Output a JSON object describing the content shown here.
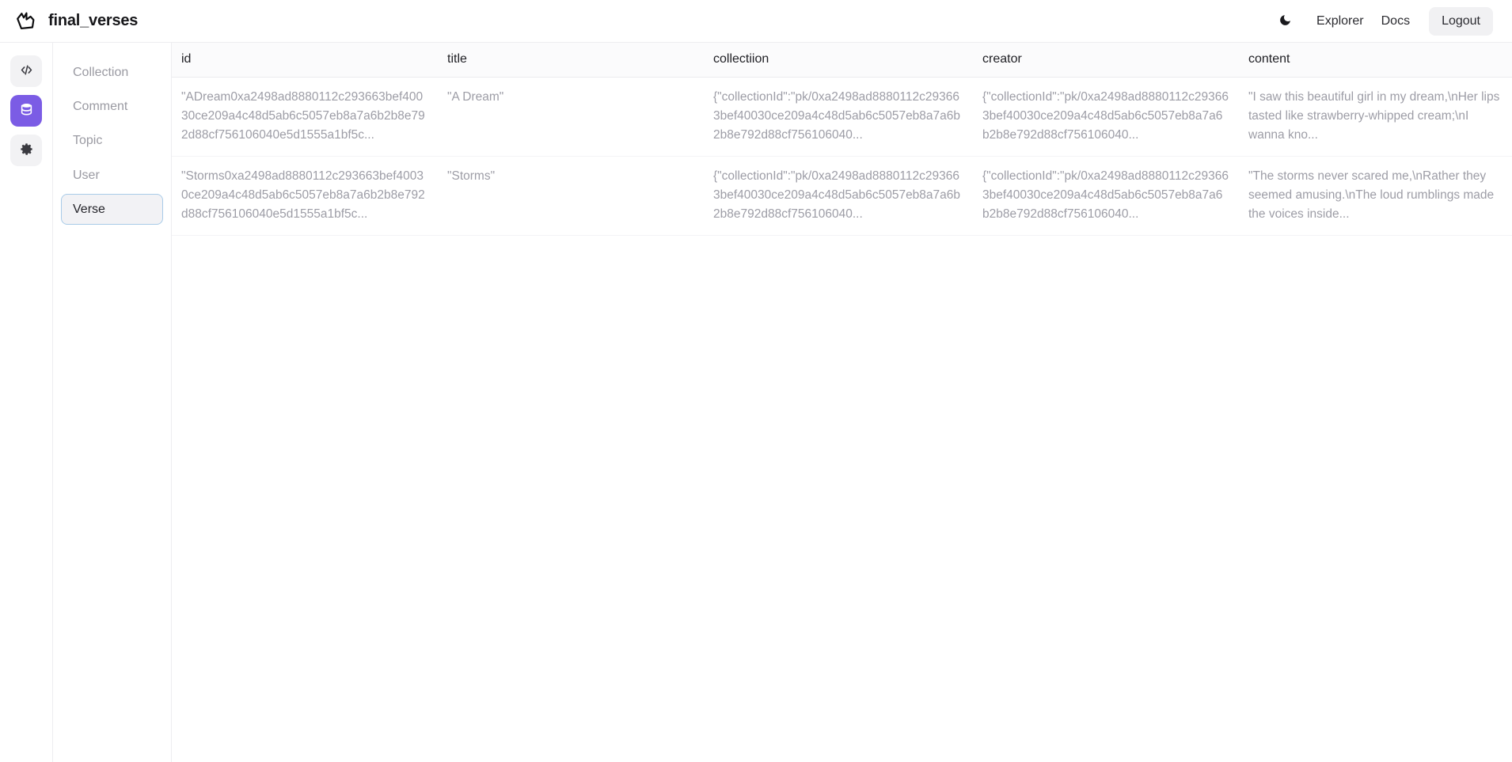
{
  "header": {
    "logo_icon": "crown-logo-icon",
    "project_name": "final_verses",
    "theme_toggle_icon": "moon-icon",
    "nav": [
      {
        "label": "Explorer",
        "name": "explorer"
      },
      {
        "label": "Docs",
        "name": "docs"
      }
    ],
    "logout_label": "Logout"
  },
  "rail": {
    "items": [
      {
        "icon": "code-brackets-icon",
        "name": "code",
        "active": false
      },
      {
        "icon": "database-icon",
        "name": "database",
        "active": true
      },
      {
        "icon": "gear-icon",
        "name": "settings",
        "active": false
      }
    ],
    "accent_color": "#7b5ce5"
  },
  "models": {
    "items": [
      {
        "label": "Collection",
        "selected": false
      },
      {
        "label": "Comment",
        "selected": false
      },
      {
        "label": "Topic",
        "selected": false
      },
      {
        "label": "User",
        "selected": false
      },
      {
        "label": "Verse",
        "selected": true
      }
    ],
    "selected_border_color": "#a8cbe8",
    "selected_bg_color": "#f2f2f5"
  },
  "table": {
    "columns": [
      {
        "key": "id",
        "label": "id"
      },
      {
        "key": "title",
        "label": "title"
      },
      {
        "key": "collectiion",
        "label": "collectiion"
      },
      {
        "key": "creator",
        "label": "creator"
      },
      {
        "key": "content",
        "label": "content"
      }
    ],
    "rows": [
      {
        "id": "\"ADream0xa2498ad8880112c293663bef40030ce209a4c48d5ab6c5057eb8a7a6b2b8e792d88cf756106040e5d1555a1bf5c...",
        "title": "\"A Dream\"",
        "collectiion": "{\"collectionId\":\"pk/0xa2498ad8880112c293663bef40030ce209a4c48d5ab6c5057eb8a7a6b2b8e792d88cf756106040...",
        "creator": "{\"collectionId\":\"pk/0xa2498ad8880112c293663bef40030ce209a4c48d5ab6c5057eb8a7a6b2b8e792d88cf756106040...",
        "content": "\"I saw this beautiful girl in my dream,\\nHer lips tasted like strawberry-whipped cream;\\nI wanna kno..."
      },
      {
        "id": "\"Storms0xa2498ad8880112c293663bef40030ce209a4c48d5ab6c5057eb8a7a6b2b8e792d88cf756106040e5d1555a1bf5c...",
        "title": "\"Storms\"",
        "collectiion": "{\"collectionId\":\"pk/0xa2498ad8880112c293663bef40030ce209a4c48d5ab6c5057eb8a7a6b2b8e792d88cf756106040...",
        "creator": "{\"collectionId\":\"pk/0xa2498ad8880112c293663bef40030ce209a4c48d5ab6c5057eb8a7a6b2b8e792d88cf756106040...",
        "content": "\"The storms never scared me,\\nRather they seemed amusing.\\nThe loud rumblings made the voices inside..."
      }
    ]
  }
}
